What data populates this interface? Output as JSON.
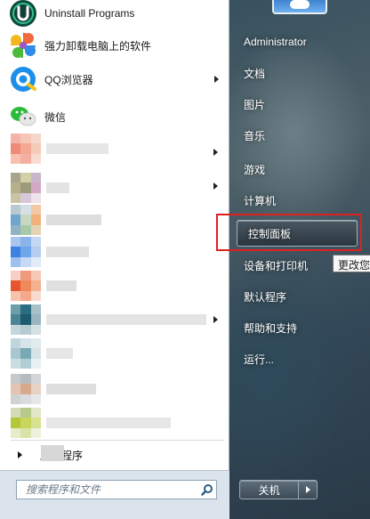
{
  "colors": {
    "accent_highlight": "#e02020",
    "left_panel_bg": "#ffffff",
    "search_bg": "#dbe4ec"
  },
  "pinned_programs": [
    {
      "label": "Uninstall Programs",
      "icon": "uninstall-icon",
      "has_submenu": false
    },
    {
      "label": "强力卸载电脑上的软件",
      "icon": "pinwheel-icon",
      "has_submenu": false
    },
    {
      "label": "QQ浏览器",
      "icon": "qq-browser-icon",
      "has_submenu": true
    },
    {
      "label": "微信",
      "icon": "wechat-icon",
      "has_submenu": false
    }
  ],
  "all_programs_label": "所有程序",
  "search": {
    "placeholder": "搜索程序和文件"
  },
  "right_panel": {
    "user": "Administrator",
    "items": [
      "文档",
      "图片",
      "音乐",
      "游戏",
      "计算机",
      "控制面板",
      "设备和打印机",
      "默认程序",
      "帮助和支持",
      "运行..."
    ],
    "selected": "控制面板"
  },
  "tooltip": "更改您",
  "shutdown": {
    "label": "关机"
  }
}
